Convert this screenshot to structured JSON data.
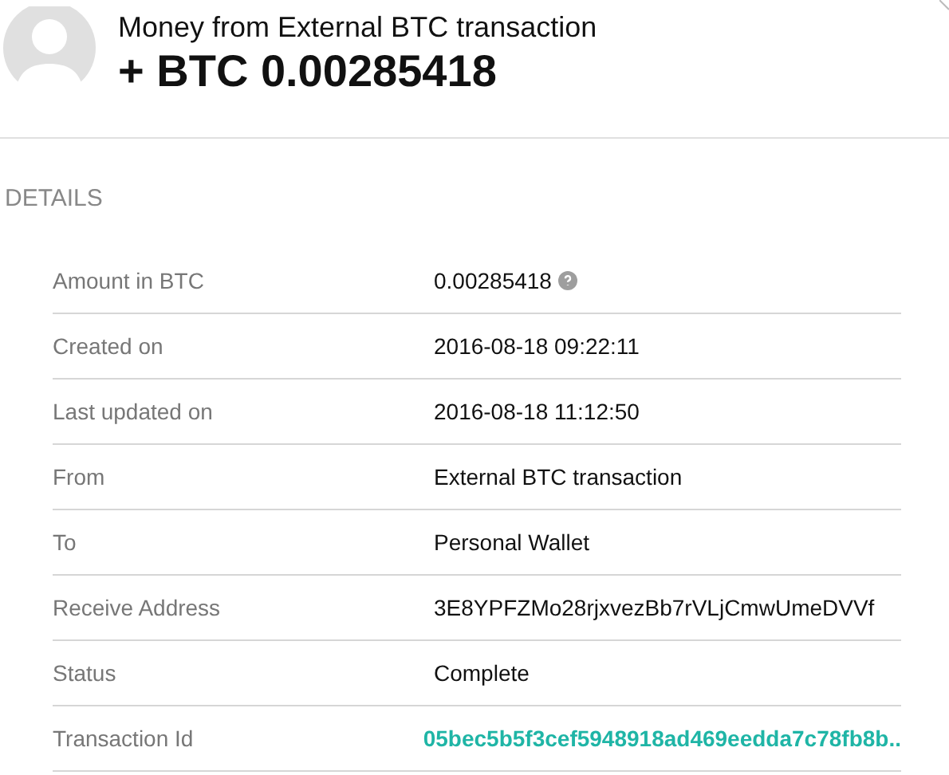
{
  "header": {
    "title": "Money from External BTC transaction",
    "amount": "+ BTC 0.00285418"
  },
  "section_title": "DETAILS",
  "details": [
    {
      "label": "Amount in BTC",
      "value": "0.00285418",
      "kind": "help"
    },
    {
      "label": "Created on",
      "value": "2016-08-18 09:22:11",
      "kind": "text"
    },
    {
      "label": "Last updated on",
      "value": "2016-08-18 11:12:50",
      "kind": "text"
    },
    {
      "label": "From",
      "value": "External BTC transaction",
      "kind": "text"
    },
    {
      "label": "To",
      "value": "Personal Wallet",
      "kind": "text"
    },
    {
      "label": "Receive Address",
      "value": "3E8YPFZMo28rjxvezBb7rVLjCmwUmeDVVf",
      "kind": "text"
    },
    {
      "label": "Status",
      "value": "Complete",
      "kind": "text"
    },
    {
      "label": "Transaction Id",
      "value": "05bec5b5f3cef5948918ad469eedda7c78fb8b..",
      "kind": "link"
    }
  ]
}
